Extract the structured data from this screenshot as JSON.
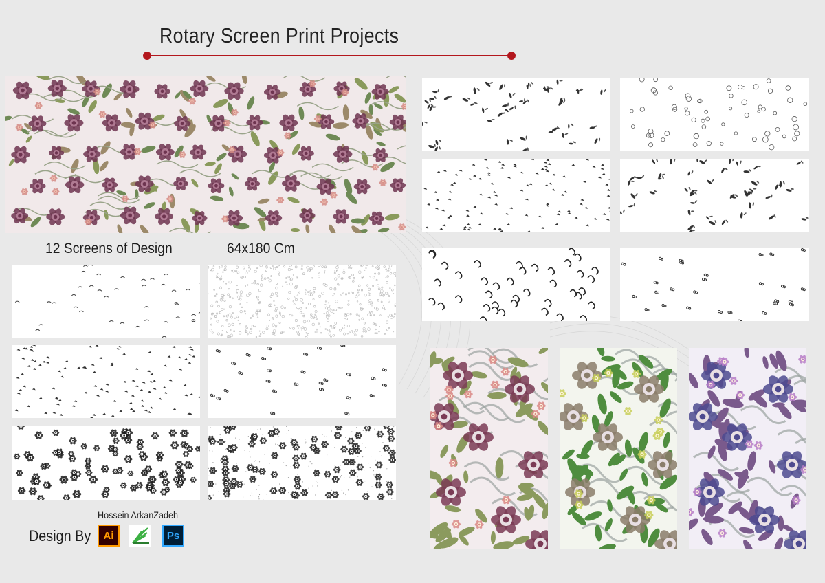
{
  "header": {
    "title": "Rotary Screen Print Projects",
    "accent_color": "#b3171d"
  },
  "caption": {
    "screens": "12  Screens of Design",
    "size": "64x180 Cm"
  },
  "credits": {
    "author": "Hossein ArkanZadeh",
    "design_by": "Design By"
  },
  "software": [
    {
      "name": "ai-icon",
      "label": "Ai",
      "color": "#ff9a00"
    },
    {
      "name": "vector-software-icon",
      "label": "",
      "color": "#3cb043"
    },
    {
      "name": "ps-icon",
      "label": "Ps",
      "color": "#31a8ff"
    }
  ],
  "colorways": [
    {
      "name": "mauve",
      "rose": "#7a3b55",
      "leaf": "#8b9a5e",
      "accent": "#d98a86",
      "ground": "#f3ecee"
    },
    {
      "name": "green",
      "rose": "#8a7d6a",
      "leaf": "#4f8d3f",
      "accent": "#c8cf5a",
      "ground": "#f3f5ee"
    },
    {
      "name": "violet",
      "rose": "#4e4a8f",
      "leaf": "#7a5a8c",
      "accent": "#b87fc8",
      "ground": "#f2eef6"
    }
  ]
}
